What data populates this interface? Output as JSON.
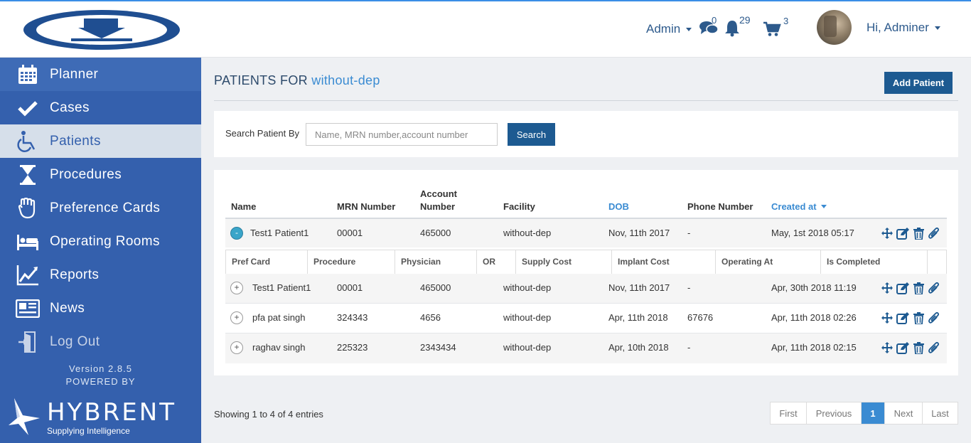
{
  "header": {
    "admin_menu_label": "Admin",
    "messages_count": "0",
    "notifications_count": "29",
    "cart_count": "3",
    "user_greeting": "Hi, Adminer"
  },
  "sidebar": {
    "items": [
      {
        "label": "Planner",
        "icon": "calendar-icon"
      },
      {
        "label": "Cases",
        "icon": "checkmark-icon"
      },
      {
        "label": "Patients",
        "icon": "wheelchair-icon"
      },
      {
        "label": "Procedures",
        "icon": "hourglass-icon"
      },
      {
        "label": "Preference Cards",
        "icon": "hand-icon"
      },
      {
        "label": "Operating Rooms",
        "icon": "bed-icon"
      },
      {
        "label": "Reports",
        "icon": "line-chart-icon"
      },
      {
        "label": "News",
        "icon": "newspaper-icon"
      },
      {
        "label": "Log Out",
        "icon": "door-exit-icon"
      }
    ],
    "version": "Version 2.8.5",
    "powered_by": "POWERED BY",
    "brand_name": "HYBRENT",
    "brand_tagline": "Supplying Intelligence"
  },
  "main": {
    "title_prefix": "PATIENTS FOR",
    "title_facility": "without-dep",
    "add_patient_label": "Add Patient",
    "search": {
      "label": "Search Patient By",
      "placeholder": "Name, MRN number,account number",
      "button_label": "Search"
    },
    "table": {
      "columns": {
        "name": "Name",
        "mrn": "MRN Number",
        "account_line1": "Account",
        "account_line2": "Number",
        "facility": "Facility",
        "dob": "DOB",
        "phone": "Phone Number",
        "created_at": "Created at"
      },
      "sub_columns": [
        "Pref Card",
        "Procedure",
        "Physician",
        "OR",
        "Supply Cost",
        "Implant Cost",
        "Operating At",
        "Is Completed"
      ],
      "rows": [
        {
          "toggle": "-",
          "name": "Test1 Patient1",
          "mrn": "00001",
          "account": "465000",
          "facility": "without-dep",
          "dob": "Nov, 11th 2017",
          "phone": "-",
          "created_at": "May, 1st 2018 05:17"
        },
        {
          "toggle": "+",
          "name": "Test1 Patient1",
          "mrn": "00001",
          "account": "465000",
          "facility": "without-dep",
          "dob": "Nov, 11th 2017",
          "phone": "-",
          "created_at": "Apr, 30th 2018 11:19"
        },
        {
          "toggle": "+",
          "name": "pfa pat singh",
          "mrn": "324343",
          "account": "4656",
          "facility": "without-dep",
          "dob": "Apr, 11th 2018",
          "phone": "67676",
          "created_at": "Apr, 11th 2018 02:26"
        },
        {
          "toggle": "+",
          "name": "raghav singh",
          "mrn": "225323",
          "account": "2343434",
          "facility": "without-dep",
          "dob": "Apr, 10th 2018",
          "phone": "-",
          "created_at": "Apr, 11th 2018 02:15"
        }
      ]
    },
    "info_text": "Showing 1 to 4 of 4 entries",
    "pagination": {
      "first": "First",
      "previous": "Previous",
      "current": "1",
      "next": "Next",
      "last": "Last"
    }
  },
  "colors": {
    "sidebar_bg": "#3460ad",
    "primary_button": "#1d5a91",
    "accent_link": "#3a8bd2"
  }
}
